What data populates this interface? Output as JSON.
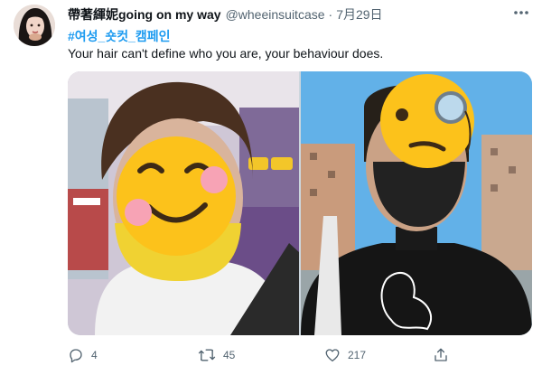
{
  "tweet": {
    "display_name": "帶著緷妮going on my way",
    "handle": "@wheeinsuitcase",
    "separator": "·",
    "date": "7月29日",
    "hashtag": "#여성_숏컷_캠페인",
    "text": "Your hair can't define who you are, your behaviour does."
  },
  "actions": {
    "reply_count": "4",
    "retweet_count": "45",
    "like_count": "217"
  },
  "icons": {
    "more": "more-icon",
    "reply": "reply-icon",
    "retweet": "retweet-icon",
    "like": "heart-icon",
    "share": "share-icon"
  },
  "colors": {
    "link": "#1d9bf0",
    "secondary_text": "#536471",
    "primary_text": "#0f1419"
  }
}
